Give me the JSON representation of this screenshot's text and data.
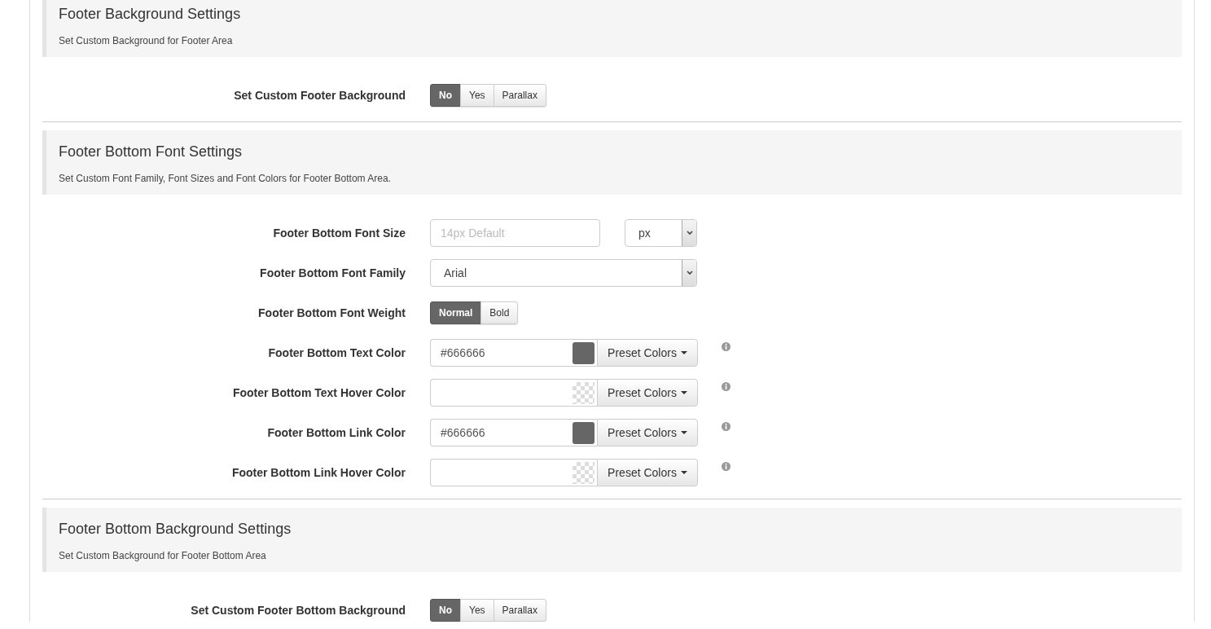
{
  "sections": [
    {
      "title": "Footer Background Settings",
      "subtitle": "Set Custom Background for Footer Area",
      "fields": [
        {
          "kind": "toggle",
          "label": "Set Custom Footer Background",
          "options": [
            {
              "label": "No",
              "selected": true
            },
            {
              "label": "Yes",
              "selected": false
            },
            {
              "label": "Parallax",
              "selected": false
            }
          ]
        }
      ]
    },
    {
      "title": "Footer Bottom Font Settings",
      "subtitle": "Set Custom Font Family, Font Sizes and Font Colors for Footer Bottom Area.",
      "fields": [
        {
          "kind": "size",
          "label": "Footer Bottom Font Size",
          "placeholder": "14px Default",
          "unit": "px"
        },
        {
          "kind": "select",
          "label": "Footer Bottom Font Family",
          "value": "Arial"
        },
        {
          "kind": "toggle",
          "label": "Footer Bottom Font Weight",
          "options": [
            {
              "label": "Normal",
              "selected": true
            },
            {
              "label": "Bold",
              "selected": false
            }
          ]
        },
        {
          "kind": "color",
          "label": "Footer Bottom Text Color",
          "value": "#666666",
          "color": "#666666",
          "button": "Preset Colors"
        },
        {
          "kind": "color",
          "label": "Footer Bottom Text Hover Color",
          "button": "Preset Colors"
        },
        {
          "kind": "color",
          "label": "Footer Bottom Link Color",
          "value": "#666666",
          "color": "#666666",
          "button": "Preset Colors"
        },
        {
          "kind": "color",
          "label": "Footer Bottom Link Hover Color",
          "button": "Preset Colors"
        }
      ]
    },
    {
      "title": "Footer Bottom Background Settings",
      "subtitle": "Set Custom Background for Footer Bottom Area",
      "fields": [
        {
          "kind": "toggle",
          "label": "Set Custom Footer Bottom Background",
          "options": [
            {
              "label": "No",
              "selected": true
            },
            {
              "label": "Yes",
              "selected": false
            },
            {
              "label": "Parallax",
              "selected": false
            }
          ]
        }
      ]
    }
  ]
}
